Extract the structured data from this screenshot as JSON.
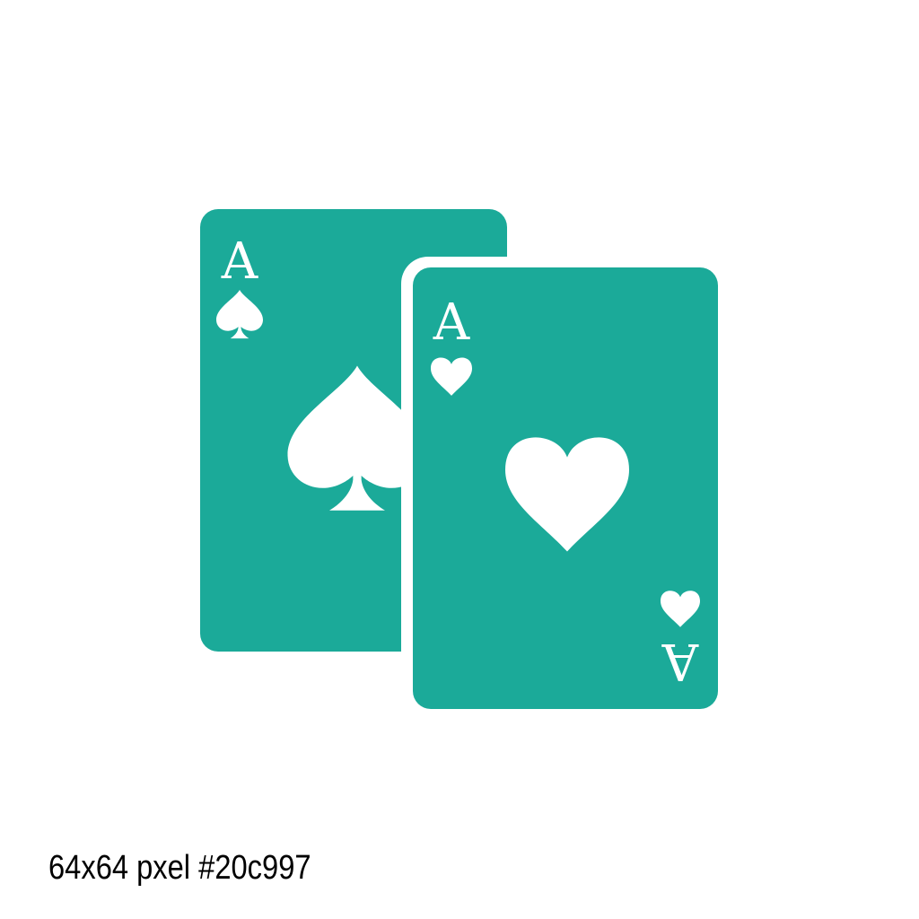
{
  "icon": {
    "name": "playing-cards-icon",
    "color": "#1baa99",
    "cut_color": "#ffffff",
    "back_card": {
      "rank": "A",
      "suit": "spade-icon"
    },
    "front_card": {
      "rank": "A",
      "suit": "heart-icon",
      "bottom_suit": "heart-icon"
    }
  },
  "caption": {
    "text": "64x64 pxel #20c997"
  }
}
